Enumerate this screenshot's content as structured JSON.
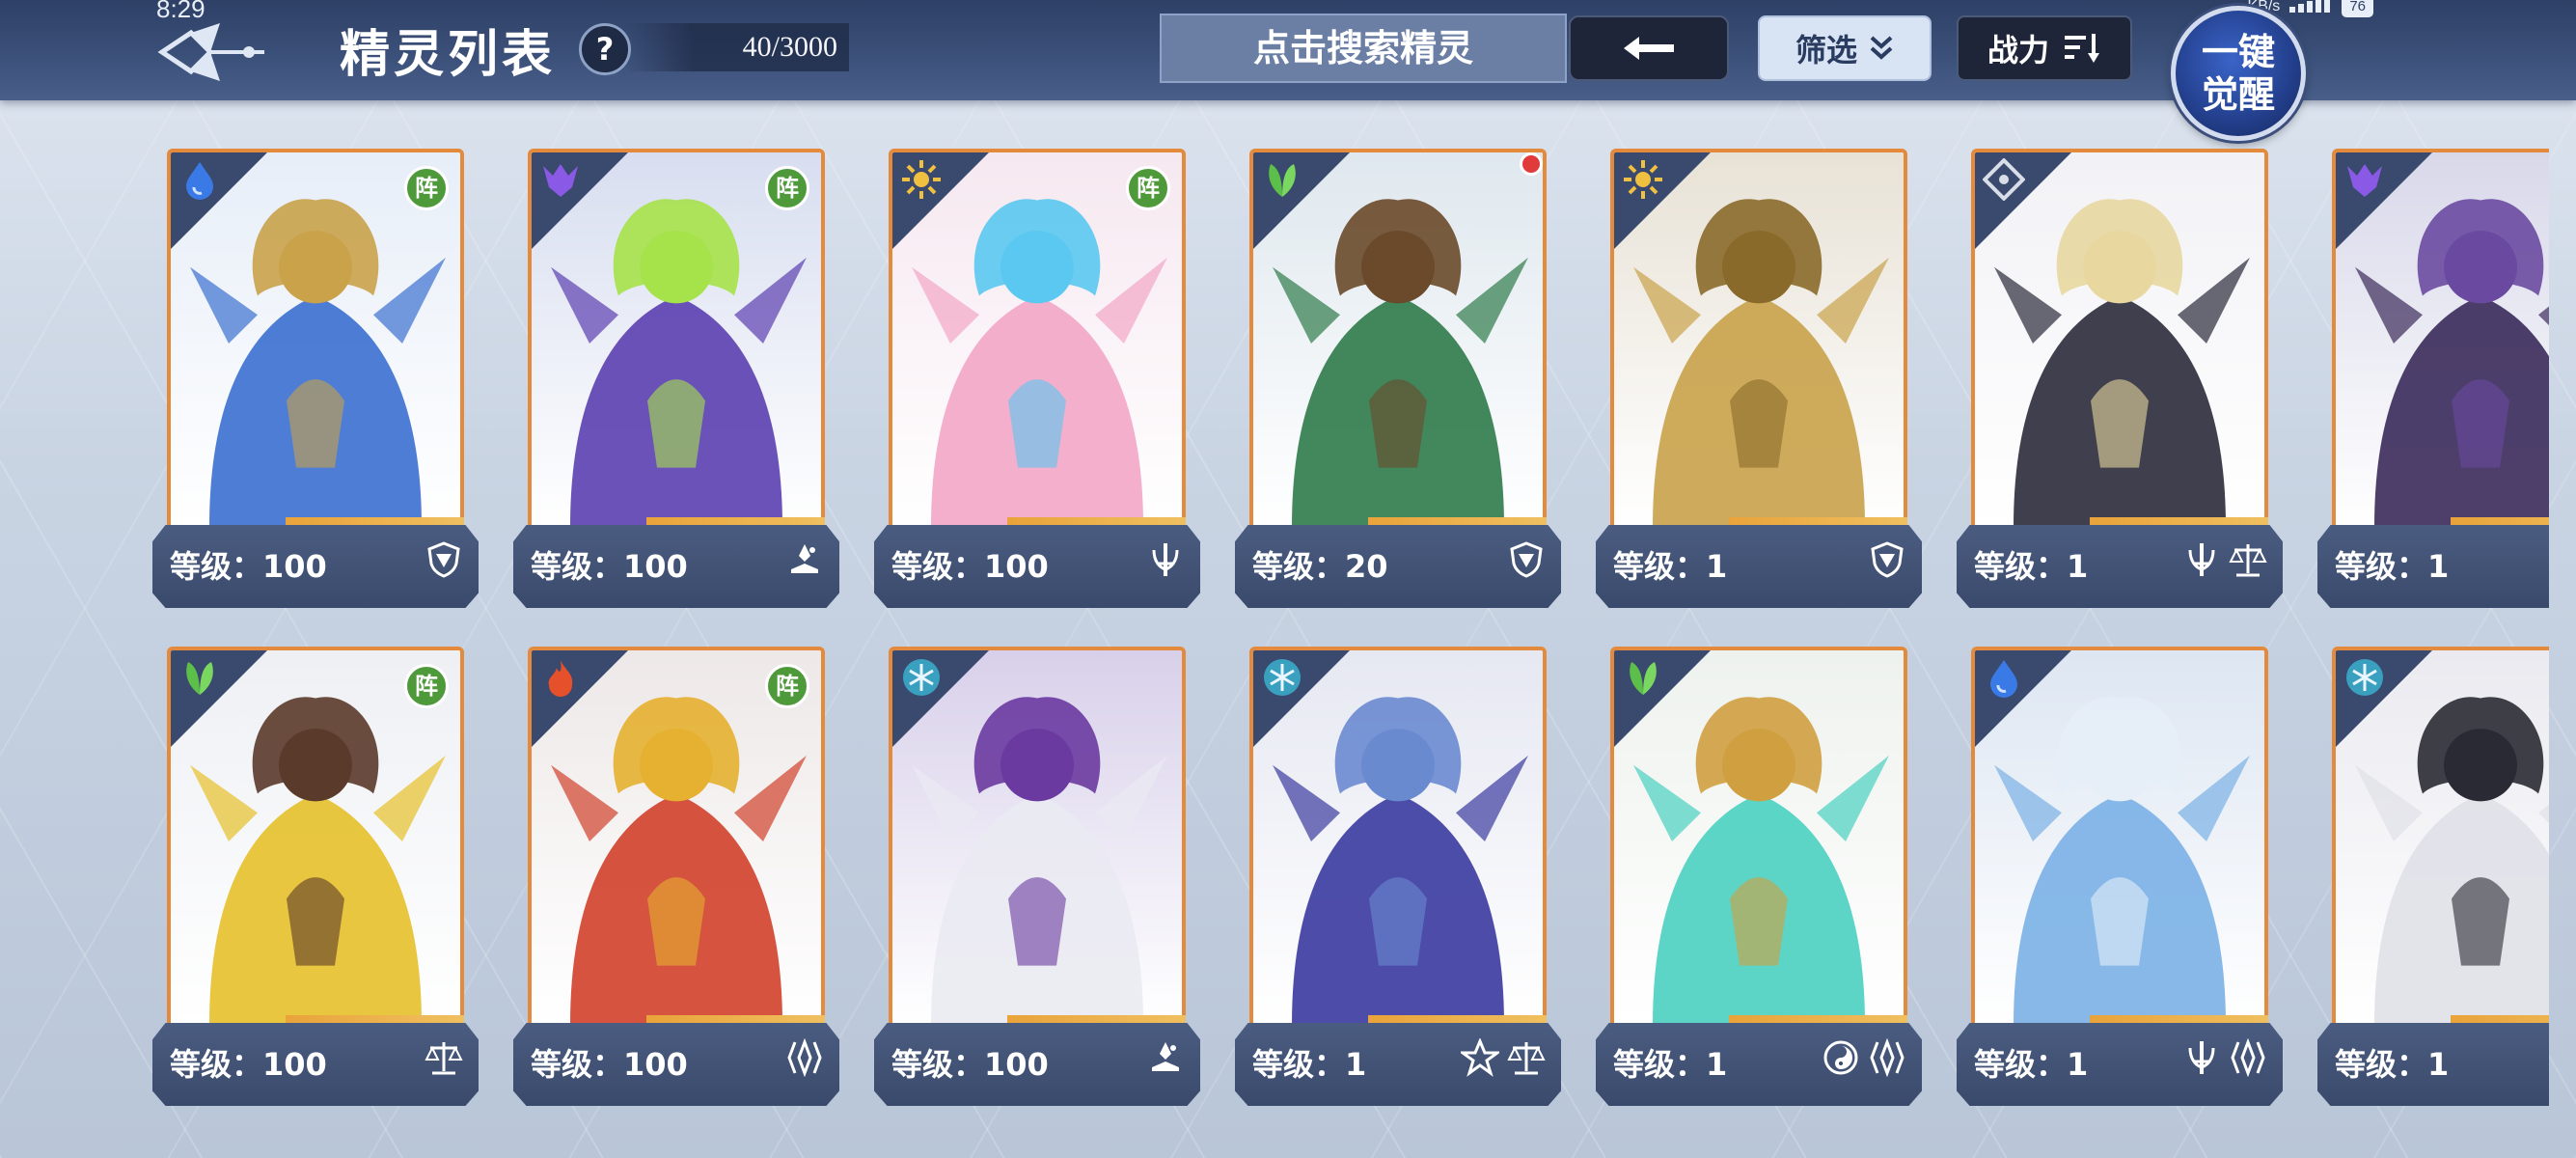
{
  "status_bar": {
    "time": "8:29",
    "network": "KB/s",
    "battery": "76"
  },
  "header": {
    "title": "精灵列表",
    "help_label": "?",
    "count": "40/3000",
    "search_placeholder": "点击搜索精灵",
    "filter_label": "筛选",
    "sort_label": "战力",
    "awaken_line1": "一键",
    "awaken_line2": "觉醒"
  },
  "theme": {
    "frame_color": "#e38a3c",
    "footer_color": "#3a4a6c",
    "topbar_color": "#3b5079"
  },
  "cards": [
    {
      "level": "等级：100",
      "element": "water-icon",
      "zhen": "阵",
      "classes": [
        "defense-icon"
      ],
      "colors": [
        "#3b6fd0",
        "#c9a24a",
        "#e7eef8"
      ]
    },
    {
      "level": "等级：100",
      "element": "shadow-icon",
      "zhen": "阵",
      "classes": [
        "support-icon"
      ],
      "colors": [
        "#5b3fb0",
        "#a6e24a",
        "#d8def0"
      ]
    },
    {
      "level": "等级：100",
      "element": "light-icon",
      "zhen": "阵",
      "classes": [
        "attack-icon"
      ],
      "colors": [
        "#f2a6c6",
        "#5ac8f0",
        "#f6e8f0"
      ]
    },
    {
      "level": "等级：20",
      "element": "grass-icon",
      "zhen": "",
      "red_dot": true,
      "classes": [
        "defense-icon"
      ],
      "colors": [
        "#2f7a4a",
        "#6a4a2a",
        "#dfe8ee"
      ]
    },
    {
      "level": "等级：1",
      "element": "light-icon",
      "zhen": "",
      "classes": [
        "defense-icon"
      ],
      "colors": [
        "#c9a24a",
        "#8a6a2a",
        "#e8e2d6"
      ]
    },
    {
      "level": "等级：1",
      "element": "neutral-icon",
      "zhen": "",
      "classes": [
        "attack-icon",
        "balance-icon"
      ],
      "colors": [
        "#2a2a3a",
        "#e8d8a0",
        "#f2f2f6"
      ]
    },
    {
      "level": "等级：1",
      "element": "shadow-icon",
      "zhen": "",
      "classes": [],
      "colors": [
        "#3a2a5a",
        "#6a4aa0",
        "#d8d8ea"
      ]
    },
    {
      "level": "等级：100",
      "element": "grass-icon",
      "zhen": "阵",
      "classes": [
        "balance-icon"
      ],
      "colors": [
        "#e6c02a",
        "#5a3a2a",
        "#eef0f4"
      ]
    },
    {
      "level": "等级：100",
      "element": "fire-icon",
      "zhen": "阵",
      "classes": [
        "speed-icon"
      ],
      "colors": [
        "#d0402a",
        "#e6b030",
        "#eee8e8"
      ]
    },
    {
      "level": "等级：100",
      "element": "ice-icon",
      "zhen": "",
      "classes": [
        "support-icon"
      ],
      "colors": [
        "#eaeaf2",
        "#6a3aa0",
        "#d8d0ea"
      ]
    },
    {
      "level": "等级：1",
      "element": "ice-icon",
      "zhen": "",
      "classes": [
        "star-icon",
        "balance-icon"
      ],
      "colors": [
        "#3a3aa0",
        "#6a8ad0",
        "#e6e8f2"
      ]
    },
    {
      "level": "等级：1",
      "element": "grass-icon",
      "zhen": "",
      "classes": [
        "spiral-icon",
        "speed-icon"
      ],
      "colors": [
        "#4ad0c0",
        "#d0a040",
        "#eef2ee"
      ]
    },
    {
      "level": "等级：1",
      "element": "water-icon",
      "zhen": "",
      "classes": [
        "attack-icon",
        "speed-icon"
      ],
      "colors": [
        "#7ab0e6",
        "#e6eef8",
        "#dde6f2"
      ]
    },
    {
      "level": "等级：1",
      "element": "ice-icon",
      "zhen": "",
      "classes": [],
      "colors": [
        "#e0e0e8",
        "#2a2a34",
        "#eaeaf0"
      ]
    }
  ]
}
